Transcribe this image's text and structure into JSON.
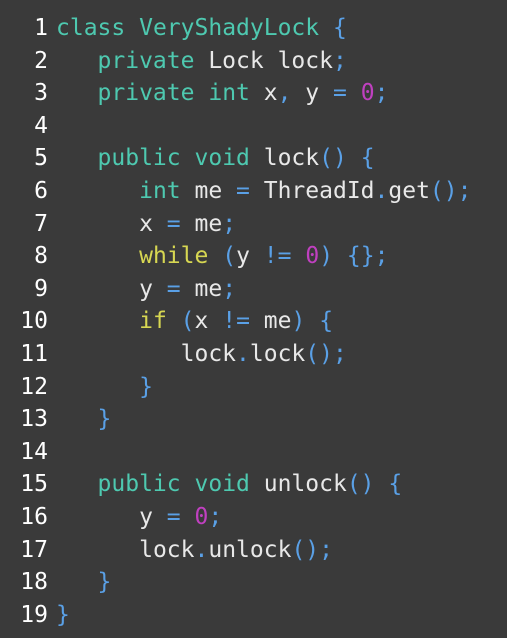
{
  "colors": {
    "background": "#3a3a3a",
    "line_number": "#ffffff",
    "keyword": "#4ec9b0",
    "plain": "#e8e8e8",
    "punctuation": "#5aa0e6",
    "number": "#c040c0",
    "control": "#d7d752"
  },
  "lines": [
    {
      "n": "1",
      "indent": "",
      "tokens": [
        [
          "kw",
          "class"
        ],
        [
          "pl",
          " "
        ],
        [
          "cls",
          "VeryShadyLock"
        ],
        [
          "pl",
          " "
        ],
        [
          "pu",
          "{"
        ]
      ]
    },
    {
      "n": "2",
      "indent": "   ",
      "tokens": [
        [
          "kw",
          "private"
        ],
        [
          "pl",
          " Lock lock"
        ],
        [
          "pu",
          ";"
        ]
      ]
    },
    {
      "n": "3",
      "indent": "   ",
      "tokens": [
        [
          "kw",
          "private"
        ],
        [
          "pl",
          " "
        ],
        [
          "kw",
          "int"
        ],
        [
          "pl",
          " x"
        ],
        [
          "pu",
          ","
        ],
        [
          "pl",
          " y "
        ],
        [
          "pu",
          "="
        ],
        [
          "pl",
          " "
        ],
        [
          "nm",
          "0"
        ],
        [
          "pu",
          ";"
        ]
      ]
    },
    {
      "n": "4",
      "indent": "",
      "tokens": []
    },
    {
      "n": "5",
      "indent": "   ",
      "tokens": [
        [
          "kw",
          "public"
        ],
        [
          "pl",
          " "
        ],
        [
          "kw",
          "void"
        ],
        [
          "pl",
          " lock"
        ],
        [
          "pu",
          "()"
        ],
        [
          "pl",
          " "
        ],
        [
          "pu",
          "{"
        ]
      ]
    },
    {
      "n": "6",
      "indent": "      ",
      "tokens": [
        [
          "kw",
          "int"
        ],
        [
          "pl",
          " me "
        ],
        [
          "pu",
          "="
        ],
        [
          "pl",
          " ThreadId"
        ],
        [
          "pu",
          "."
        ],
        [
          "pl",
          "get"
        ],
        [
          "pu",
          "();"
        ]
      ]
    },
    {
      "n": "7",
      "indent": "      ",
      "tokens": [
        [
          "pl",
          "x "
        ],
        [
          "pu",
          "="
        ],
        [
          "pl",
          " me"
        ],
        [
          "pu",
          ";"
        ]
      ]
    },
    {
      "n": "8",
      "indent": "      ",
      "tokens": [
        [
          "cf",
          "while"
        ],
        [
          "pl",
          " "
        ],
        [
          "pu",
          "("
        ],
        [
          "pl",
          "y "
        ],
        [
          "pu",
          "!="
        ],
        [
          "pl",
          " "
        ],
        [
          "nm",
          "0"
        ],
        [
          "pu",
          ")"
        ],
        [
          "pl",
          " "
        ],
        [
          "pu",
          "{};"
        ]
      ]
    },
    {
      "n": "9",
      "indent": "      ",
      "tokens": [
        [
          "pl",
          "y "
        ],
        [
          "pu",
          "="
        ],
        [
          "pl",
          " me"
        ],
        [
          "pu",
          ";"
        ]
      ]
    },
    {
      "n": "10",
      "indent": "      ",
      "tokens": [
        [
          "cf",
          "if"
        ],
        [
          "pl",
          " "
        ],
        [
          "pu",
          "("
        ],
        [
          "pl",
          "x "
        ],
        [
          "pu",
          "!="
        ],
        [
          "pl",
          " me"
        ],
        [
          "pu",
          ")"
        ],
        [
          "pl",
          " "
        ],
        [
          "pu",
          "{"
        ]
      ]
    },
    {
      "n": "11",
      "indent": "         ",
      "tokens": [
        [
          "pl",
          "lock"
        ],
        [
          "pu",
          "."
        ],
        [
          "pl",
          "lock"
        ],
        [
          "pu",
          "();"
        ]
      ]
    },
    {
      "n": "12",
      "indent": "      ",
      "tokens": [
        [
          "pu",
          "}"
        ]
      ]
    },
    {
      "n": "13",
      "indent": "   ",
      "tokens": [
        [
          "pu",
          "}"
        ]
      ]
    },
    {
      "n": "14",
      "indent": "",
      "tokens": []
    },
    {
      "n": "15",
      "indent": "   ",
      "tokens": [
        [
          "kw",
          "public"
        ],
        [
          "pl",
          " "
        ],
        [
          "kw",
          "void"
        ],
        [
          "pl",
          " unlock"
        ],
        [
          "pu",
          "()"
        ],
        [
          "pl",
          " "
        ],
        [
          "pu",
          "{"
        ]
      ]
    },
    {
      "n": "16",
      "indent": "      ",
      "tokens": [
        [
          "pl",
          "y "
        ],
        [
          "pu",
          "="
        ],
        [
          "pl",
          " "
        ],
        [
          "nm",
          "0"
        ],
        [
          "pu",
          ";"
        ]
      ]
    },
    {
      "n": "17",
      "indent": "      ",
      "tokens": [
        [
          "pl",
          "lock"
        ],
        [
          "pu",
          "."
        ],
        [
          "pl",
          "unlock"
        ],
        [
          "pu",
          "();"
        ]
      ]
    },
    {
      "n": "18",
      "indent": "   ",
      "tokens": [
        [
          "pu",
          "}"
        ]
      ]
    },
    {
      "n": "19",
      "indent": "",
      "tokens": [
        [
          "pu",
          "}"
        ]
      ]
    }
  ]
}
